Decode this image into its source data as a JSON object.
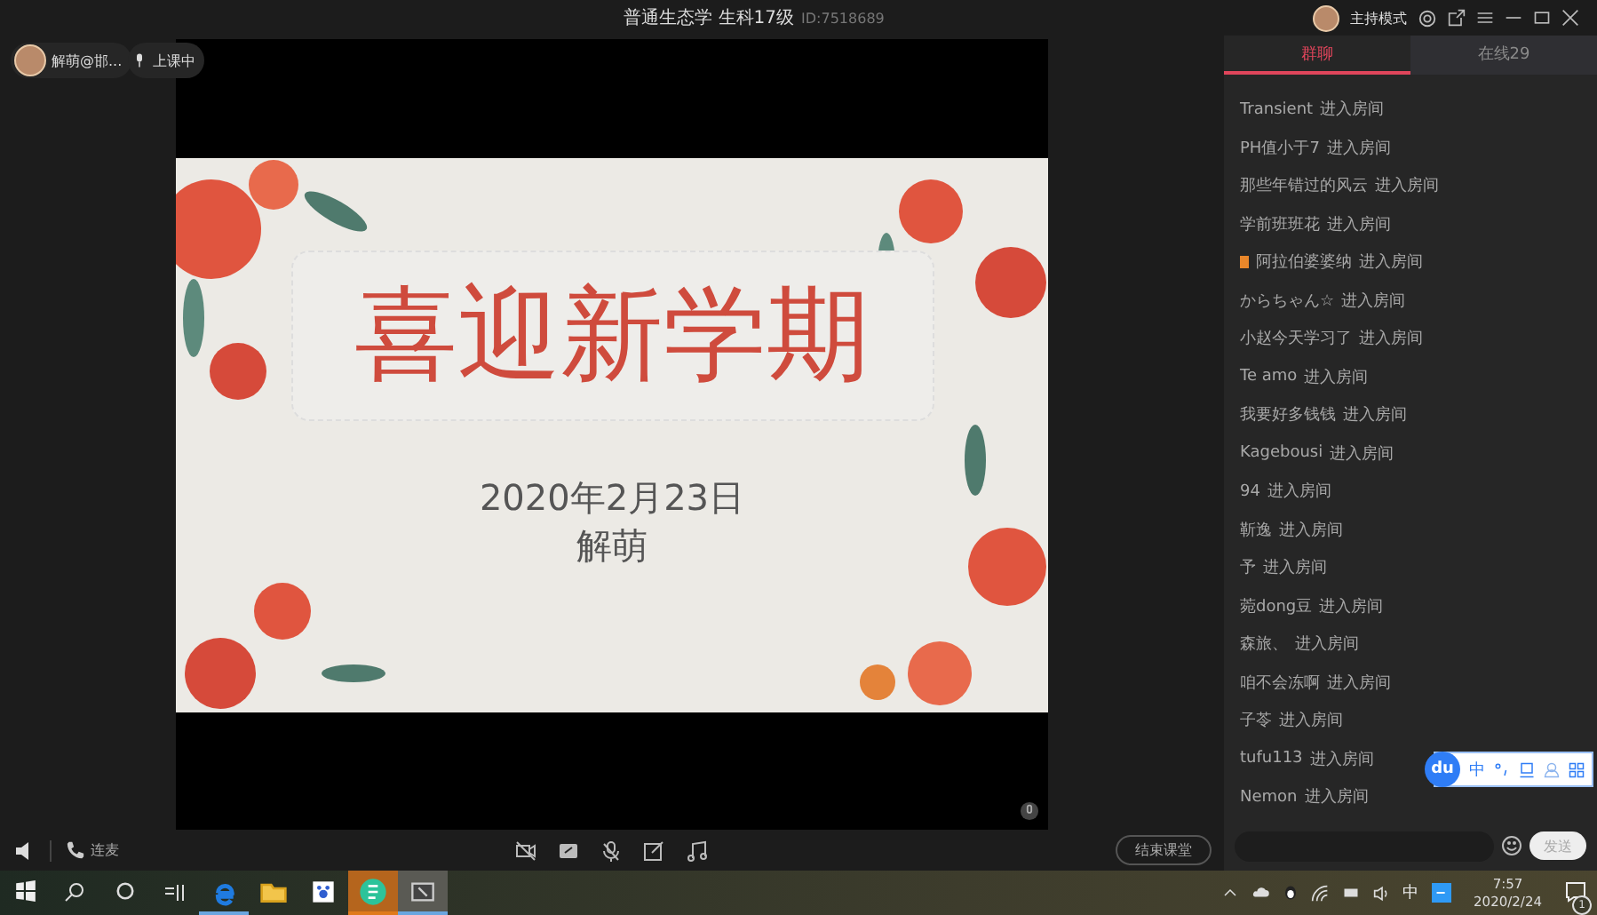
{
  "window": {
    "title": "普通生态学 生科17级",
    "room_id": "ID:7518689",
    "mode": "主持模式"
  },
  "user_chip": {
    "name": "解萌@邯..."
  },
  "status_chip": {
    "label": "上课中"
  },
  "slide": {
    "title": "喜迎新学期",
    "date": "2020年2月23日",
    "author": "解萌"
  },
  "controls": {
    "mic_label": "连麦",
    "end_button": "结束课堂"
  },
  "tabs": [
    {
      "label": "群聊",
      "selected": true
    },
    {
      "label": "在线29",
      "selected": false
    }
  ],
  "chat": [
    {
      "name": "Transient",
      "action": "进入房间",
      "kind": "plain"
    },
    {
      "name": "PH值小于7",
      "action": "进入房间",
      "kind": "plain"
    },
    {
      "name": "那些年错过的风云",
      "action": "进入房间",
      "kind": "plain"
    },
    {
      "name": "学前班班花",
      "action": "进入房间",
      "kind": "plain"
    },
    {
      "name": "阿拉伯婆婆纳",
      "action": "进入房间",
      "kind": "badge"
    },
    {
      "name": "からちゃん☆",
      "action": "进入房间",
      "kind": "plain"
    },
    {
      "name": "小赵今天学习了",
      "action": "进入房间",
      "kind": "plain"
    },
    {
      "name": "Te amo",
      "action": "进入房间",
      "kind": "plain"
    },
    {
      "name": "我要好多钱钱",
      "action": "进入房间",
      "kind": "plain"
    },
    {
      "name": "Kagebousi",
      "action": "进入房间",
      "kind": "plain"
    },
    {
      "name": "94",
      "action": "进入房间",
      "kind": "plain"
    },
    {
      "name": "靳逸",
      "action": "进入房间",
      "kind": "plain"
    },
    {
      "name": "予",
      "action": "进入房间",
      "kind": "plain"
    },
    {
      "name": "菀dong豆",
      "action": "进入房间",
      "kind": "plain"
    },
    {
      "name": "森旅、",
      "action": "进入房间",
      "kind": "plain"
    },
    {
      "name": "咱不会冻啊",
      "action": "进入房间",
      "kind": "plain"
    },
    {
      "name": "子苓",
      "action": "进入房间",
      "kind": "plain"
    },
    {
      "name": "tufu113",
      "action": "进入房间",
      "kind": "plain"
    },
    {
      "name": "Nemon",
      "action": "进入房间",
      "kind": "plain"
    }
  ],
  "composer": {
    "send": "发送"
  },
  "ime": {
    "logo": "du",
    "label": "中"
  },
  "taskbar": {
    "apps": [
      {
        "kind": "edge",
        "running": true,
        "highlighted": false,
        "focused": false
      },
      {
        "kind": "folder",
        "running": false,
        "highlighted": false,
        "focused": false
      },
      {
        "kind": "paw",
        "running": false,
        "highlighted": false,
        "focused": false
      },
      {
        "kind": "green",
        "running": true,
        "highlighted": true,
        "focused": false
      },
      {
        "kind": "screen",
        "running": true,
        "highlighted": false,
        "focused": true
      }
    ],
    "lang": "中",
    "time": "7:57",
    "date": "2020/2/24",
    "notifications": "1"
  }
}
